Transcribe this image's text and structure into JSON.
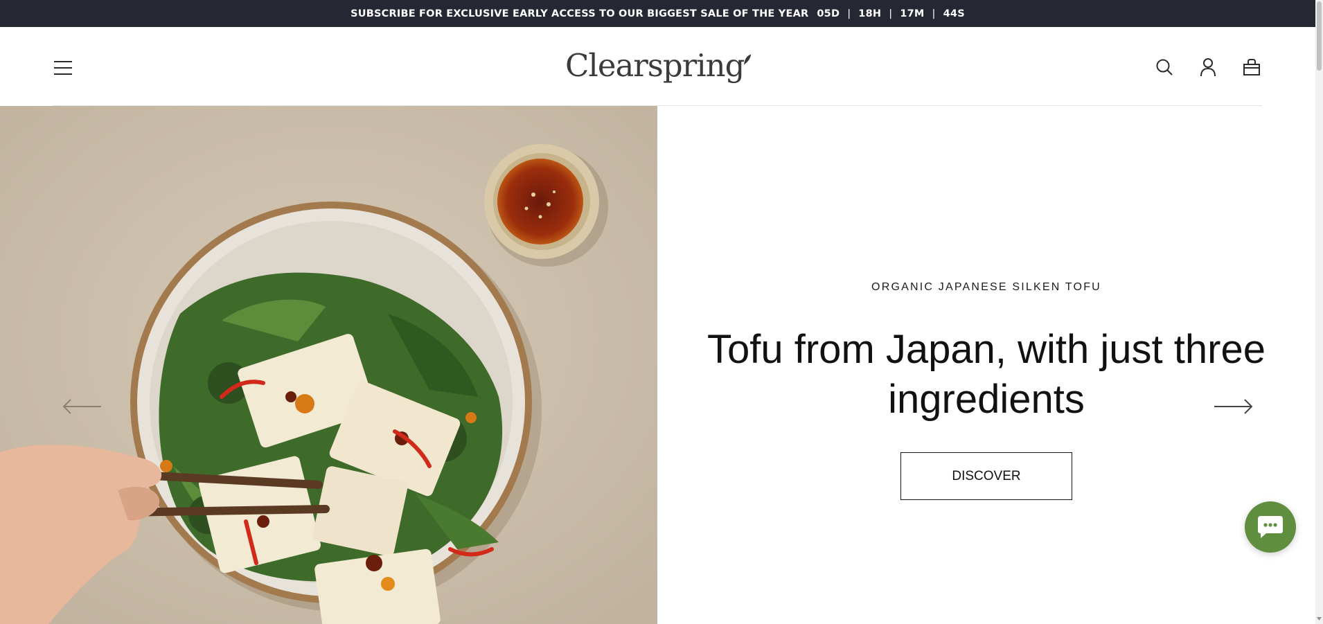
{
  "announcement": {
    "text": "SUBSCRIBE FOR EXCLUSIVE EARLY ACCESS TO OUR BIGGEST SALE OF THE YEAR",
    "countdown": {
      "days": "05D",
      "hours": "18H",
      "minutes": "17M",
      "seconds": "44S",
      "separator": "|"
    }
  },
  "header": {
    "logo_text": "Clearspring",
    "icons": [
      "menu-icon",
      "search-icon",
      "account-icon",
      "bag-icon"
    ]
  },
  "hero": {
    "eyebrow": "ORGANIC JAPANESE SILKEN TOFU",
    "headline": "Tofu from Japan, with just three ingredients",
    "cta_label": "DISCOVER",
    "image_description_icon": "tofu-dish-image"
  },
  "colors": {
    "announcement_bg": "#252733",
    "chat_green": "#5e8e3e",
    "text": "#111111"
  }
}
